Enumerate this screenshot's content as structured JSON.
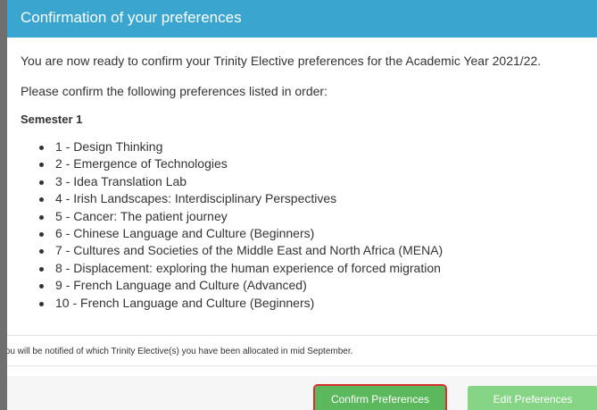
{
  "dialog": {
    "title": "Confirmation of your preferences",
    "intro": "You are now ready to confirm your Trinity Elective preferences for the Academic Year 2021/22.",
    "instruction": "Please confirm the following preferences listed in order:",
    "semester_heading": "Semester 1",
    "preferences": [
      "1 - Design Thinking",
      "2 - Emergence of Technologies",
      "3 - Idea Translation Lab",
      "4 - Irish Landscapes: Interdisciplinary Perspectives",
      "5 - Cancer: The patient journey",
      "6 - Chinese Language and Culture (Beginners)",
      "7 - Cultures and Societies of the Middle East and North Africa (MENA)",
      "8 - Displacement: exploring the human experience of forced migration",
      "9 - French Language and Culture (Advanced)",
      "10 - French Language and Culture (Beginners)"
    ],
    "notice": "You will be notified of which Trinity Elective(s) you have been allocated in mid September.",
    "confirm_label": "Confirm Preferences",
    "edit_label": "Edit Preferences"
  },
  "colors": {
    "header": "#3aa6cf",
    "button": "#5cb85c",
    "button_disabled": "#86d586",
    "focus_outline": "#d6312e"
  }
}
